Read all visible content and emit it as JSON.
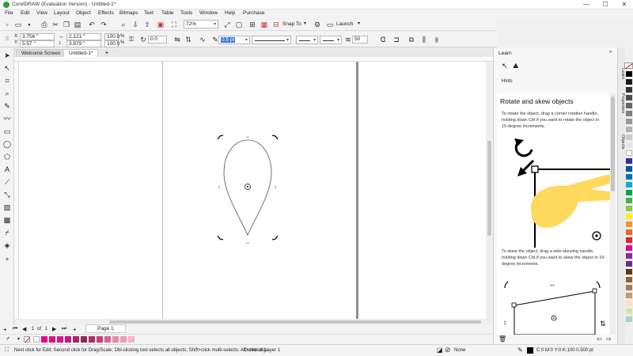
{
  "app": {
    "title": "CorelDRAW (Evaluation Version) - Untitled-1*"
  },
  "window_controls": {
    "minimize": "—",
    "maximize": "☐",
    "close": "✕"
  },
  "menu": [
    "File",
    "Edit",
    "View",
    "Layout",
    "Object",
    "Effects",
    "Bitmaps",
    "Text",
    "Table",
    "Tools",
    "Window",
    "Help",
    "Purchase"
  ],
  "toolbar": {
    "zoom": "72%",
    "snap_to": "Snap To",
    "launch": "Launch"
  },
  "property_bar": {
    "x": "3.756 \"",
    "y": "5.57 \"",
    "width": "2.121 \"",
    "height": "3.879 \"",
    "scale_x": "100.0",
    "scale_y": "100.0",
    "pct": "%",
    "rotation": "0.0",
    "outline_width": "0.5 pt",
    "miter": "50"
  },
  "tabs": {
    "welcome": "Welcome Screen",
    "doc": "Untitled-1*",
    "add": "+"
  },
  "pages": {
    "current": "1",
    "of": "of",
    "total": "1",
    "page_tab": "Page 1"
  },
  "status": {
    "hint": "Next click for Edit; Second click for Drag/Scale; Dbl-clicking tool selects all objects; Shift+click multi-selects; Alt+click digs",
    "layer": "Curve on Layer 1",
    "fill_none": "None",
    "outline_info": "C:0 M:0 Y:0 K:100  0.500 pt"
  },
  "learn": {
    "header": "Learn",
    "hints_label": "Hints",
    "title": "Rotate and skew objects",
    "para1": "To rotate the object, drag a corner rotation handle, holding down Ctrl if you want to rotate the object in 15-degree increments.",
    "para2": "To skew the object, drag a side skewing handle, holding down Ctrl if you want to skew the object in 15-degree increments."
  },
  "docker_tabs": [
    "Learn",
    "Properties",
    "Objects"
  ],
  "colors": {
    "bottom_palette": [
      "#ffffff",
      "#ec008c",
      "#e2127a",
      "#d7188b",
      "#c2187f",
      "#a3266c",
      "#8e2a5a",
      "#b03060",
      "#c8407a",
      "#d86590",
      "#e48aa8",
      "#f09bb8",
      "#f5b3c8"
    ],
    "vertical_palette": [
      "#000000",
      "#1a1a1a",
      "#333333",
      "#4d4d4d",
      "#666666",
      "#808080",
      "#999999",
      "#b3b3b3",
      "#cccccc",
      "#e6e6e6",
      "#ffffff",
      "#2e3192",
      "#0054a6",
      "#0072bc",
      "#00aeef",
      "#00a651",
      "#39b54a",
      "#8dc63f",
      "#fff200",
      "#f7941d",
      "#f26522",
      "#ed1c24",
      "#ec008c",
      "#92278f",
      "#662d91",
      "#603913",
      "#8c6239",
      "#a67c52",
      "#c69c6d",
      "#ffe3c4",
      "#d2e7a5",
      "#a3d6c7"
    ],
    "hand": "#ffd85e"
  }
}
